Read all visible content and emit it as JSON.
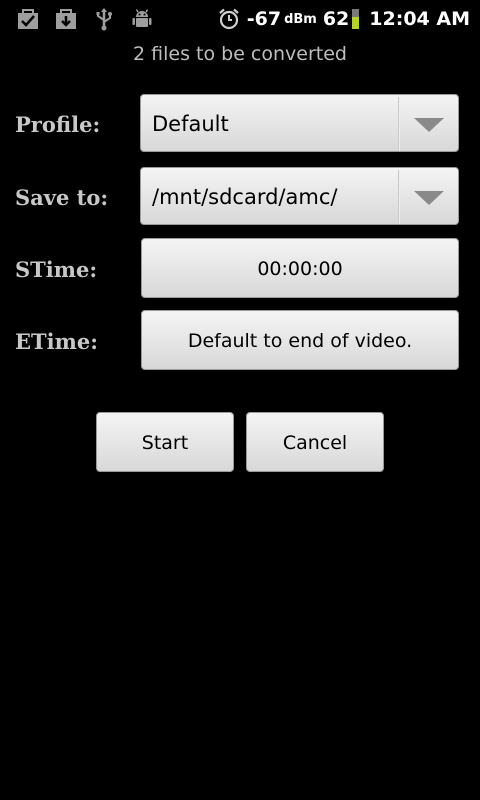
{
  "status_bar": {
    "icons": [
      "task-check-icon",
      "download-icon",
      "usb-icon",
      "android-debug-icon",
      "alarm-icon"
    ],
    "signal": "-67",
    "signal_unit": "dBm",
    "battery_level": "62",
    "battery_fraction": 0.62,
    "time": "12:04 AM"
  },
  "subtitle": "2  files to be converted",
  "form": {
    "profile": {
      "label": "Profile:",
      "value": "Default"
    },
    "save_to": {
      "label": "Save to:",
      "value": "/mnt/sdcard/amc/"
    },
    "stime": {
      "label": "STime:",
      "value": "00:00:00"
    },
    "etime": {
      "label": "ETime:",
      "value": "Default to end of video."
    }
  },
  "actions": {
    "start_label": "Start",
    "cancel_label": "Cancel"
  },
  "colors": {
    "background": "#000000",
    "label": "#c8c8c8",
    "subtitle": "#bdbdbd",
    "battery_fill": "#b6d12a"
  }
}
